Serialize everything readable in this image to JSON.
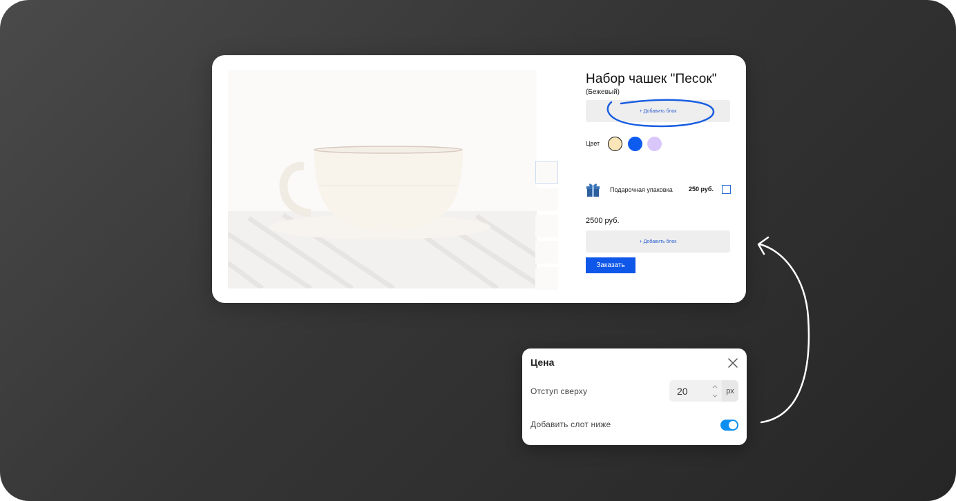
{
  "product": {
    "title": "Набор чашек \"Песок\"",
    "variant": "(Бежевый)",
    "add_block_label": "+ Добавить блок",
    "color_label": "Цвет",
    "colors": [
      "#f9e5b7",
      "#0e5bf0",
      "#d9c7fb"
    ],
    "gift": {
      "icon": "gift-icon",
      "label": "Подарочная упаковка",
      "price": "250 руб."
    },
    "price": "2500 руб.",
    "add_block_label_2": "+ Добавить блок",
    "order_label": "Заказать"
  },
  "panel": {
    "title": "Цена",
    "offset_label": "Отступ сверху",
    "offset_value": "20",
    "offset_unit": "px",
    "slot_label": "Добавить слот ниже",
    "slot_enabled": true
  },
  "accent": "#0f57e8"
}
